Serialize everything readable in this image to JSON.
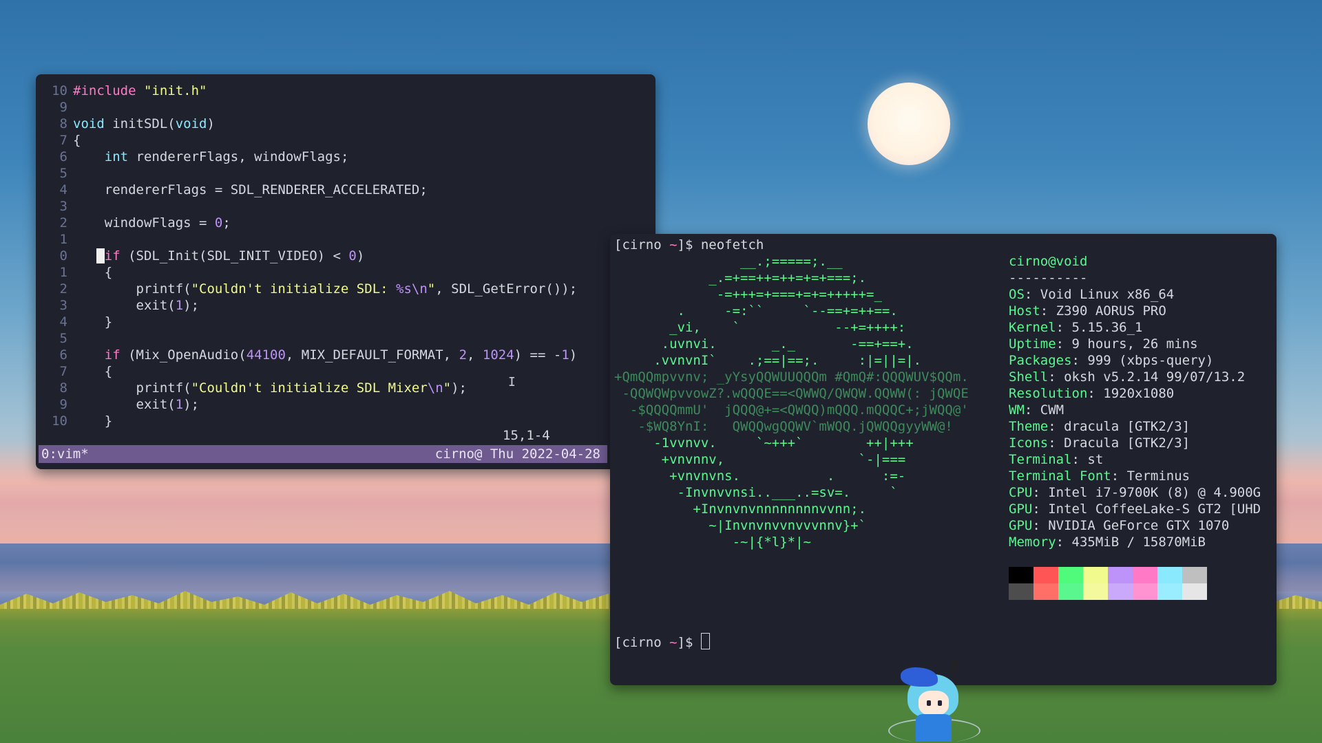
{
  "vim": {
    "gutter": [
      "10",
      "9",
      "8",
      "7",
      "6",
      "5",
      "4",
      "3",
      "2",
      "1",
      "0",
      "1",
      "2",
      "3",
      "4",
      "5",
      "6",
      "7",
      "8",
      "9",
      "10"
    ],
    "ruler": "15,1-4",
    "code": {
      "l1_pp": "#include",
      "l1_str": "\"init.h\"",
      "l3_type": "void",
      "l3_name": " initSDL(",
      "l3_arg": "void",
      "l3_close": ")",
      "l4": "{",
      "l5_type": "int",
      "l5_rest": " rendererFlags, windowFlags;",
      "l7": "    rendererFlags = SDL_RENDERER_ACCELERATED;",
      "l9_a": "    windowFlags = ",
      "l9_num": "0",
      "l9_b": ";",
      "l11_kw": "if",
      "l11_a": " (SDL_Init(SDL_INIT_VIDEO) < ",
      "l11_num": "0",
      "l11_b": ")",
      "l12": "    {",
      "l13_a": "        printf(",
      "l13_str": "\"Couldn't initialize SDL: ",
      "l13_fmt": "%s",
      "l13_esc": "\\n",
      "l13_end": "\"",
      "l13_b": ", SDL_GetError());",
      "l14_a": "        exit(",
      "l14_num": "1",
      "l14_b": ");",
      "l15": "    }",
      "l17_kw": "if",
      "l17_a": " (Mix_OpenAudio(",
      "l17_n1": "44100",
      "l17_b": ", MIX_DEFAULT_FORMAT, ",
      "l17_n2": "2",
      "l17_c": ", ",
      "l17_n3": "1024",
      "l17_d": ") == -",
      "l17_n4": "1",
      "l17_e": ")",
      "l18": "    {",
      "l19_a": "        printf(",
      "l19_str": "\"Couldn't initialize SDL Mixer",
      "l19_esc": "\\n",
      "l19_end": "\"",
      "l19_b": ");",
      "l20_a": "        exit(",
      "l20_num": "1",
      "l20_b": ");",
      "l21": "    }"
    }
  },
  "tmux": {
    "left": "0:vim*",
    "right": "cirno@ Thu 2022-04-28"
  },
  "neofetch": {
    "command_prompt": "[cirno ",
    "command_tilde": "~",
    "command_end": "]$ ",
    "command": "neofetch",
    "art": [
      "                __.;=====;.__",
      "            _.=+==++=++=+=+===;.",
      "             -=+++=+===+=+=+++++=_",
      "        .     -=:``     `--==+=++==.",
      "       _vi,    `            --+=++++:",
      "      .uvnvi.       _._       -==+==+.",
      "     .vvnvnI`    .;==|==;.     :|=||=|.",
      "+QmQQmpvvnv; _yYsyQQWUUQQQm #QmQ#:QQQWUV$QQm.",
      " -QQWQWpvvowZ?.wQQQE==<QWWQ/QWQW.QQWW(: jQWQE",
      "  -$QQQQmmU'  jQQQ@+=<QWQQ)mQQQ.mQQQC+;jWQQ@'",
      "   -$WQ8YnI:   QWQQwgQQWV`mWQQ.jQWQQgyyWW@!",
      "     -1vvnvv.     `~+++`        ++|+++",
      "      +vnvnnv,                 `-|===",
      "       +vnvnvns.           .      :=-",
      "        -Invnvvnsi..___..=sv=.     `",
      "          +Invnvnvnnnnnnnnvvnn;.",
      "            ~|Invnvnvvnvvvnnv}+`",
      "               -~|{*l}*|~"
    ],
    "user": "cirno@void",
    "separator": "----------",
    "info": [
      {
        "label": "OS",
        "value": "Void Linux x86_64"
      },
      {
        "label": "Host",
        "value": "Z390 AORUS PRO"
      },
      {
        "label": "Kernel",
        "value": "5.15.36_1"
      },
      {
        "label": "Uptime",
        "value": "9 hours, 26 mins"
      },
      {
        "label": "Packages",
        "value": "999 (xbps-query)"
      },
      {
        "label": "Shell",
        "value": "oksh v5.2.14 99/07/13.2"
      },
      {
        "label": "Resolution",
        "value": "1920x1080"
      },
      {
        "label": "WM",
        "value": "CWM"
      },
      {
        "label": "Theme",
        "value": "dracula [GTK2/3]"
      },
      {
        "label": "Icons",
        "value": "Dracula [GTK2/3]"
      },
      {
        "label": "Terminal",
        "value": "st"
      },
      {
        "label": "Terminal Font",
        "value": "Terminus"
      },
      {
        "label": "CPU",
        "value": "Intel i7-9700K (8) @ 4.900G"
      },
      {
        "label": "GPU",
        "value": "Intel CoffeeLake-S GT2 [UHD"
      },
      {
        "label": "GPU",
        "value": "NVIDIA GeForce GTX 1070"
      },
      {
        "label": "Memory",
        "value": "435MiB / 15870MiB"
      }
    ],
    "palette": [
      {
        "top": "#000000",
        "bottom": "#4d4d4d"
      },
      {
        "top": "#ff5555",
        "bottom": "#ff6e67"
      },
      {
        "top": "#50fa7b",
        "bottom": "#5af78e"
      },
      {
        "top": "#f1fa8c",
        "bottom": "#f4f99d"
      },
      {
        "top": "#bd93f9",
        "bottom": "#caa9fa"
      },
      {
        "top": "#ff79c6",
        "bottom": "#ff92d0"
      },
      {
        "top": "#8be9fd",
        "bottom": "#9aedfe"
      },
      {
        "top": "#bfbfbf",
        "bottom": "#e6e6e6"
      }
    ],
    "prompt_user": "[cirno ",
    "prompt_tilde": "~",
    "prompt_end": "]$ "
  },
  "colors": {
    "terminal_bg": "#1f212d",
    "tmux_bar": "#6e5a8f",
    "accent_green": "#5af78e",
    "accent_pink": "#ff79c6"
  },
  "icons": {
    "text_cursor": "I"
  }
}
